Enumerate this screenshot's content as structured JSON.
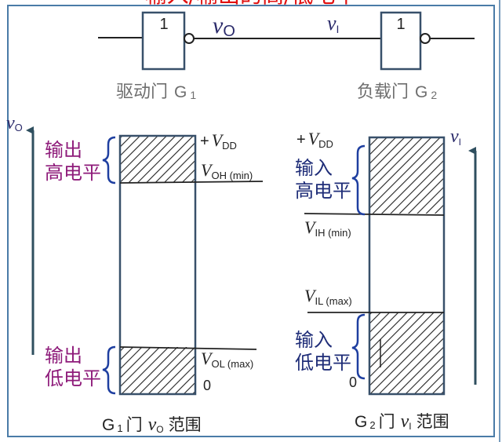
{
  "top_title": "输入/输出的高/低电平",
  "gates": {
    "driver": {
      "symbol": "1",
      "label": "驱动门",
      "name": "G",
      "sub": "1"
    },
    "load": {
      "symbol": "1",
      "label": "负载门",
      "name": "G",
      "sub": "2"
    },
    "signal_out": {
      "v": "v",
      "sub": "O"
    },
    "signal_in": {
      "v": "v",
      "sub": "I"
    }
  },
  "left_panel": {
    "axis": {
      "v": "v",
      "sub": "O"
    },
    "vdd": {
      "prefix": "+",
      "v": "V",
      "sub": "DD"
    },
    "voh": {
      "v": "V",
      "sub": "OH (min)"
    },
    "vol": {
      "v": "V",
      "sub": "OL (max)"
    },
    "zero": "0",
    "high_label": [
      "输出",
      "高电平"
    ],
    "low_label": [
      "输出",
      "低电平"
    ],
    "caption": {
      "name": "G",
      "sub": "1",
      "mid": "门",
      "v": "v",
      "vsub": "O",
      "tail": "范围"
    }
  },
  "right_panel": {
    "axis": {
      "v": "v",
      "sub": "I"
    },
    "vdd": {
      "prefix": "+",
      "v": "V",
      "sub": "DD"
    },
    "vih": {
      "v": "V",
      "sub": "IH (min)"
    },
    "vil": {
      "v": "V",
      "sub": "IL (max)"
    },
    "zero": "0",
    "high_label": [
      "输入",
      "高电平"
    ],
    "low_label": [
      "输入",
      "低电平"
    ],
    "caption": {
      "name": "G",
      "sub": "2",
      "mid": "门",
      "v": "v",
      "vsub": "I",
      "tail": "范围"
    }
  },
  "colors": {
    "frame": "#4a7ba7",
    "line": "#222222",
    "output_label": "#8e1b7a",
    "input_label": "#1f2d78",
    "brace": "#1f3fa0",
    "arrow": "#2f4f5f",
    "gate_border": "#38506a",
    "title": "#e01010"
  }
}
